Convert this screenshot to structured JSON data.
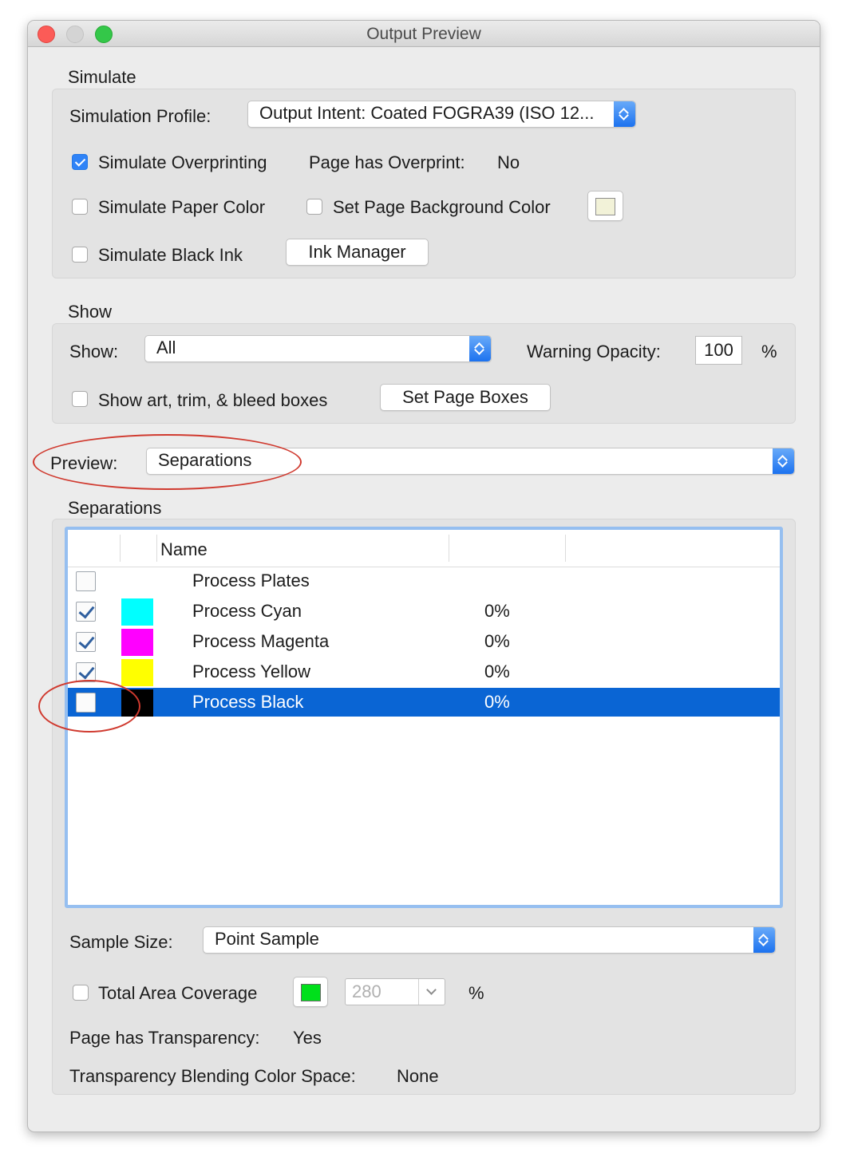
{
  "window": {
    "title": "Output Preview"
  },
  "simulate": {
    "section_label": "Simulate",
    "profile_label": "Simulation Profile:",
    "profile_value": "Output Intent: Coated FOGRA39 (ISO 12...",
    "simulate_overprinting": {
      "label": "Simulate Overprinting",
      "checked": true
    },
    "page_has_overprint_label": "Page has Overprint:",
    "page_has_overprint_value": "No",
    "simulate_paper_color": {
      "label": "Simulate Paper Color",
      "checked": false
    },
    "set_page_background": {
      "label": "Set Page Background Color",
      "checked": false,
      "swatch_color": "#f2f2d8"
    },
    "simulate_black_ink": {
      "label": "Simulate Black Ink",
      "checked": false
    },
    "ink_manager_button": "Ink Manager"
  },
  "show": {
    "section_label": "Show",
    "show_label": "Show:",
    "show_value": "All",
    "warning_opacity_label": "Warning Opacity:",
    "warning_opacity_value": "100",
    "percent": "%",
    "show_boxes": {
      "label": "Show art, trim, & bleed boxes",
      "checked": false
    },
    "set_page_boxes_button": "Set Page Boxes"
  },
  "preview": {
    "label": "Preview:",
    "value": "Separations"
  },
  "separations": {
    "section_label": "Separations",
    "columns": [
      "",
      "",
      "Name",
      "",
      ""
    ],
    "rows": [
      {
        "checked": false,
        "swatch": "",
        "name": "Process Plates",
        "coverage": "",
        "selected": false
      },
      {
        "checked": true,
        "swatch": "#00ffff",
        "name": "Process Cyan",
        "coverage": "0%",
        "selected": false
      },
      {
        "checked": true,
        "swatch": "#ff00ff",
        "name": "Process Magenta",
        "coverage": "0%",
        "selected": false
      },
      {
        "checked": true,
        "swatch": "#ffff00",
        "name": "Process Yellow",
        "coverage": "0%",
        "selected": false
      },
      {
        "checked": false,
        "swatch": "#000000",
        "name": "Process Black",
        "coverage": "0%",
        "selected": true
      }
    ]
  },
  "sample": {
    "label": "Sample Size:",
    "value": "Point Sample"
  },
  "total_area_coverage": {
    "label": "Total Area Coverage",
    "checked": false,
    "swatch_color": "#00e01b",
    "value": "280",
    "percent": "%"
  },
  "transparency": {
    "page_has_transparency_label": "Page has Transparency:",
    "page_has_transparency_value": "Yes",
    "blending_label": "Transparency Blending Color Space:",
    "blending_value": "None"
  },
  "colors": {
    "accent": "#1c72ef",
    "selection": "#0a65d4",
    "annotation": "#d03a2f"
  }
}
